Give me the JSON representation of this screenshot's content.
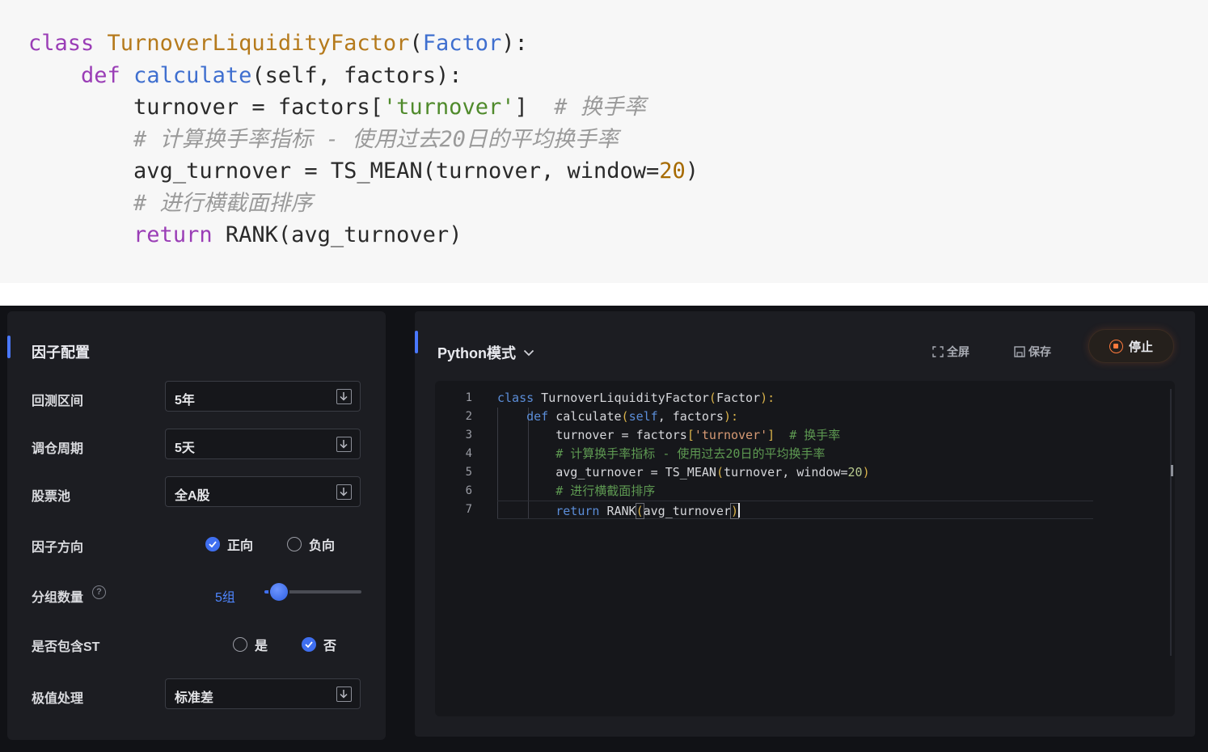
{
  "snippet": {
    "lines": [
      {
        "indent": "",
        "t1": "class",
        "t2": " ",
        "t3": "TurnoverLiquidityFactor",
        "t4": "(",
        "t5": "Factor",
        "t6": "):"
      },
      {
        "indent": "    ",
        "t1": "def",
        "t2": " ",
        "t3": "calculate",
        "t4": "(self, factors):"
      },
      {
        "indent": "        ",
        "t1": "turnover = factors[",
        "t2": "'turnover'",
        "t3": "]  ",
        "t4": "# 换手率"
      },
      {
        "indent": "        ",
        "t1": "# 计算换手率指标 - 使用过去20日的平均换手率"
      },
      {
        "indent": "        ",
        "t1": "avg_turnover = TS_MEAN(turnover, window=",
        "t2": "20",
        "t3": ")"
      },
      {
        "indent": "        ",
        "t1": "# 进行横截面排序"
      },
      {
        "indent": "        ",
        "t1": "return",
        "t2": " RANK(avg_turnover)"
      }
    ]
  },
  "config": {
    "title": "因子配置",
    "backtest_label": "回测区间",
    "backtest_value": "5年",
    "rebalance_label": "调仓周期",
    "rebalance_value": "5天",
    "pool_label": "股票池",
    "pool_value": "全A股",
    "direction_label": "因子方向",
    "direction_positive": "正向",
    "direction_negative": "负向",
    "direction_selected": "正向",
    "groups_label": "分组数量",
    "groups_help": "?",
    "groups_value": "5组",
    "groups_slider_fraction": 0.15,
    "st_label": "是否包含ST",
    "st_yes": "是",
    "st_no": "否",
    "st_selected": "否",
    "extreme_label": "极值处理",
    "extreme_value": "标准差"
  },
  "editor_header": {
    "mode": "Python模式",
    "fullscreen": "全屏",
    "save": "保存",
    "stop": "停止"
  },
  "editor": {
    "line_numbers": [
      "1",
      "2",
      "3",
      "4",
      "5",
      "6",
      "7"
    ],
    "l1": {
      "a": "class",
      "b": " TurnoverLiquidityFactor",
      "c": "(",
      "d": "Factor",
      "e": "):"
    },
    "l2": {
      "a": "    ",
      "b": "def",
      "c": " calculate",
      "d": "(",
      "e": "self",
      "f": ", factors",
      "g": "):"
    },
    "l3": {
      "a": "        turnover = factors",
      "b": "[",
      "c": "'turnover'",
      "d": "]",
      "e": "  # 换手率"
    },
    "l4": {
      "a": "        # 计算换手率指标 - 使用过去20日的平均换手率"
    },
    "l5": {
      "a": "        avg_turnover = TS_MEAN",
      "b": "(",
      "c": "turnover, window=",
      "d": "20",
      "e": ")"
    },
    "l6": {
      "a": "        # 进行横截面排序"
    },
    "l7": {
      "a": "        ",
      "b": "return",
      "c": " RANK",
      "d": "(",
      "e": "avg_turnover",
      "f": ")"
    }
  },
  "colors": {
    "accent": "#3f6ff0",
    "stop": "#ff7a3d",
    "background": "#111216",
    "panel": "#1c1d22"
  },
  "icons": [
    "chevron-down-icon",
    "fullscreen-icon",
    "save-icon",
    "stop-icon",
    "dropdown-arrow-icon",
    "checkmark-icon",
    "help-icon"
  ]
}
